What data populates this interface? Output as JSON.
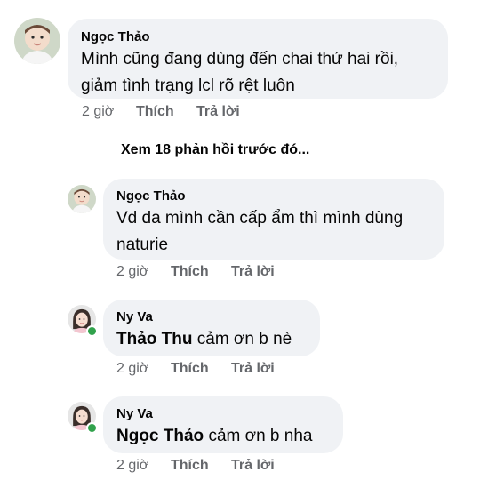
{
  "comments": [
    {
      "author": "Ngọc Thảo",
      "line1": "Mình cũng đang dùng đến chai thứ hai rồi,",
      "line2": "giảm tình trạng lcl rõ rệt luôn",
      "time": "2 giờ",
      "like": "Thích",
      "reply": "Trả lời"
    },
    {
      "author": "Ngọc Thảo",
      "line1": "Vd da mình cần cấp ẩm thì mình dùng",
      "line2": "naturie",
      "time": "2 giờ",
      "like": "Thích",
      "reply": "Trả lời"
    },
    {
      "author": "Ny Va",
      "mention": "Thảo Thu",
      "text": " cảm ơn b nè",
      "time": "2 giờ",
      "like": "Thích",
      "reply": "Trả lời"
    },
    {
      "author": "Ny Va",
      "mention": "Ngọc Thảo",
      "text": " cảm ơn b nha",
      "time": "2 giờ",
      "like": "Thích",
      "reply": "Trả lời"
    }
  ],
  "view_more": "Xem 18 phản hồi trước đó...",
  "colors": {
    "bubble": "#f0f2f5",
    "muted_text": "#65676b",
    "online": "#31a24c"
  },
  "icons": [
    "baby-avatar-photo",
    "girl-avatar-photo",
    "online-status-dot"
  ]
}
